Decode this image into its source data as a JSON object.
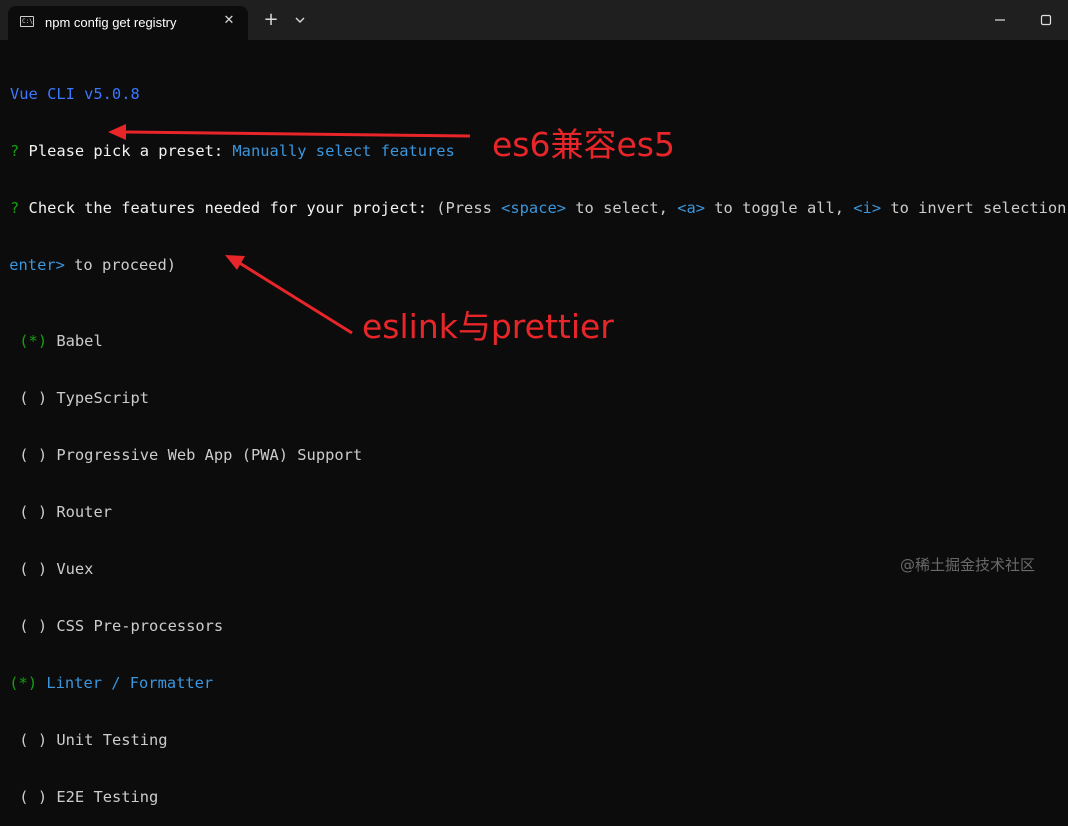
{
  "window": {
    "tab_title": "npm config get registry",
    "tab_icon": "command-prompt-icon",
    "tab_icon_text": "C:\\",
    "close_glyph": "✕",
    "new_tab_glyph": "+"
  },
  "terminal": {
    "line1": "Vue CLI v5.0.8",
    "line2_q": "?",
    "line2_text": " Please pick a preset: ",
    "line2_answer": "Manually select features",
    "line3_q": "?",
    "line3_text": " Check the features needed for your project: ",
    "line3_hint_a": "(Press ",
    "line3_space": "<space>",
    "line3_hint_b": " to select, ",
    "line3_a": "<a>",
    "line3_hint_c": " to toggle all, ",
    "line3_i": "<i>",
    "line3_hint_d": " to invert selection, an",
    "line4_enter": "<enter>",
    "line4_rest": " to proceed)",
    "cursor": ">",
    "features": [
      {
        "mark": "(*)",
        "label": "Babel",
        "checked": true,
        "cursor": false
      },
      {
        "mark": "( )",
        "label": "TypeScript",
        "checked": false,
        "cursor": false
      },
      {
        "mark": "( )",
        "label": "Progressive Web App (PWA) Support",
        "checked": false,
        "cursor": false
      },
      {
        "mark": "( )",
        "label": "Router",
        "checked": false,
        "cursor": false
      },
      {
        "mark": "( )",
        "label": "Vuex",
        "checked": false,
        "cursor": false
      },
      {
        "mark": "( )",
        "label": "CSS Pre-processors",
        "checked": false,
        "cursor": false
      },
      {
        "mark": "(*)",
        "label": "Linter / Formatter",
        "checked": true,
        "cursor": true
      },
      {
        "mark": "( )",
        "label": "Unit Testing",
        "checked": false,
        "cursor": false
      },
      {
        "mark": "( )",
        "label": "E2E Testing",
        "checked": false,
        "cursor": false
      }
    ]
  },
  "annotations": {
    "babel_note": "es6兼容es5",
    "linter_note": "eslink与prettier"
  },
  "watermark": "@稀土掘金技术社区",
  "colors": {
    "background": "#0c0c0c",
    "titlebar": "#1f1f1f",
    "vue_cli": "#3b78ff",
    "question_mark": "#13a10e",
    "answer": "#3a96dd",
    "annotation": "#e8262a"
  }
}
